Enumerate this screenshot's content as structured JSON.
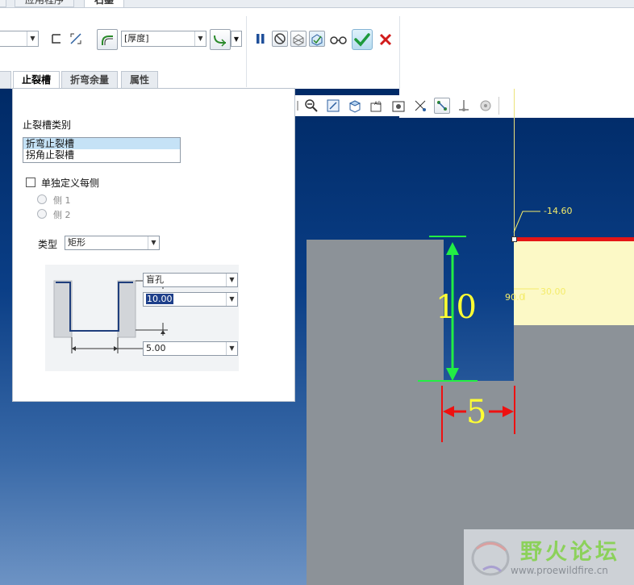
{
  "ribbon": {
    "tabs": [
      {
        "label": "应用程序"
      },
      {
        "label": "石墨",
        "active": true
      }
    ],
    "thickness_combo": {
      "value": "[厚度]"
    },
    "left_combo": {
      "value": ""
    }
  },
  "subtabs": [
    {
      "label": "止裂槽",
      "active": true
    },
    {
      "label": "折弯余量"
    },
    {
      "label": "属性"
    }
  ],
  "panel": {
    "relief_category_label": "止裂槽类别",
    "relief_categories": [
      {
        "label": "折弯止裂槽",
        "selected": true
      },
      {
        "label": "拐角止裂槽",
        "selected": false
      }
    ],
    "define_each_side_label": "单独定义每侧",
    "define_each_side_checked": false,
    "side1_label": "侧 1",
    "side2_label": "侧 2",
    "type_label": "类型",
    "type_value": "矩形",
    "depth_type_value": "盲孔",
    "depth_value": "10.00",
    "width_value": "5.00"
  },
  "viewport": {
    "dim_main": "-14.60",
    "dim_angle": "90.0",
    "dim_right": "30.00",
    "dim_depth_big": "10",
    "dim_width_big": "5",
    "colors": {
      "background": "#0a3e86",
      "model_gray": "#8c9298",
      "surface_yellow": "#fcf9c6",
      "edge_red": "#e51616",
      "dimension_green": "#22ee44",
      "dimension_red": "#ee1111"
    }
  },
  "watermark": {
    "title": "野火论坛",
    "url": "www.proewildfire.cn"
  }
}
